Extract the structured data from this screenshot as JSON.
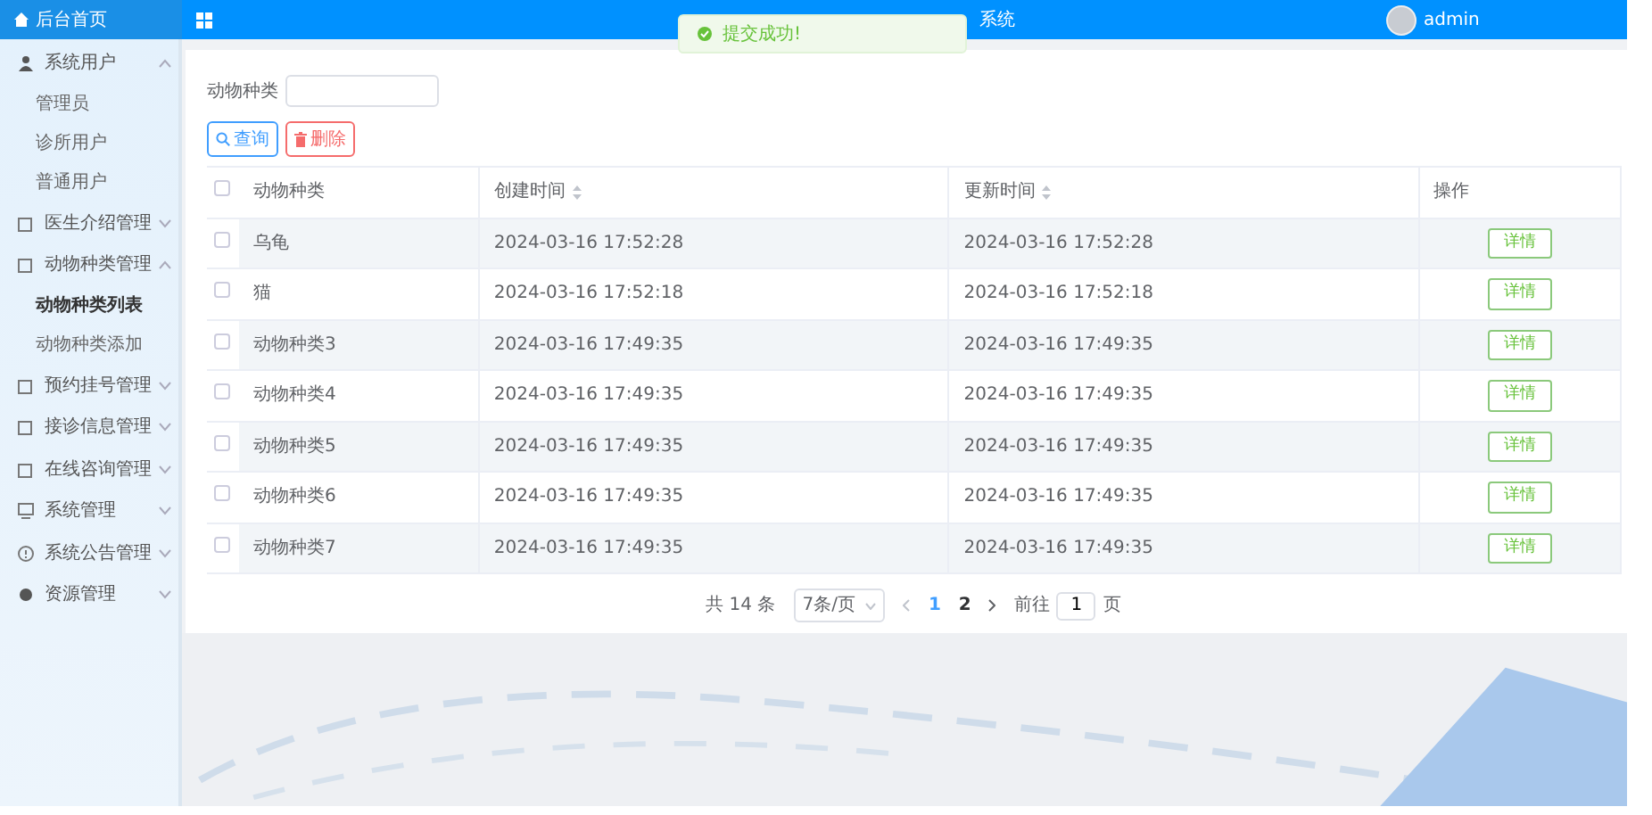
{
  "header": {
    "home_label": "后台首页",
    "title": "系统",
    "user": "admin"
  },
  "toast": {
    "message": "提交成功!"
  },
  "sidebar": {
    "items": [
      {
        "label": "系统用户",
        "expanded": true,
        "children": [
          {
            "label": "管理员",
            "selected": false
          },
          {
            "label": "诊所用户",
            "selected": false
          },
          {
            "label": "普通用户",
            "selected": false
          }
        ]
      },
      {
        "label": "医生介绍管理",
        "expanded": false
      },
      {
        "label": "动物种类管理",
        "expanded": true,
        "children": [
          {
            "label": "动物种类列表",
            "selected": true
          },
          {
            "label": "动物种类添加",
            "selected": false
          }
        ]
      },
      {
        "label": "预约挂号管理",
        "expanded": false
      },
      {
        "label": "接诊信息管理",
        "expanded": false
      },
      {
        "label": "在线咨询管理",
        "expanded": false
      },
      {
        "label": "系统管理",
        "expanded": false
      },
      {
        "label": "系统公告管理",
        "expanded": false
      },
      {
        "label": "资源管理",
        "expanded": false
      }
    ]
  },
  "search": {
    "label": "动物种类"
  },
  "buttons": [
    {
      "kind": "search",
      "label": "查询"
    },
    {
      "kind": "delete",
      "label": "删除"
    }
  ],
  "table": {
    "header_checked": false,
    "columns": [
      {
        "label": "动物种类",
        "sortable": false
      },
      {
        "label": "创建时间",
        "sortable": true
      },
      {
        "label": "更新时间",
        "sortable": true
      },
      {
        "label": "操作",
        "sortable": false
      }
    ],
    "rows": [
      {
        "checked": false,
        "name": "乌龟",
        "created": "2024-03-16 17:52:28",
        "updated": "2024-03-16 17:52:28",
        "action": "详情"
      },
      {
        "checked": false,
        "name": "猫",
        "created": "2024-03-16 17:52:18",
        "updated": "2024-03-16 17:52:18",
        "action": "详情"
      },
      {
        "checked": false,
        "name": "动物种类3",
        "created": "2024-03-16 17:49:35",
        "updated": "2024-03-16 17:49:35",
        "action": "详情"
      },
      {
        "checked": false,
        "name": "动物种类4",
        "created": "2024-03-16 17:49:35",
        "updated": "2024-03-16 17:49:35",
        "action": "详情"
      },
      {
        "checked": false,
        "name": "动物种类5",
        "created": "2024-03-16 17:49:35",
        "updated": "2024-03-16 17:49:35",
        "action": "详情"
      },
      {
        "checked": false,
        "name": "动物种类6",
        "created": "2024-03-16 17:49:35",
        "updated": "2024-03-16 17:49:35",
        "action": "详情"
      },
      {
        "checked": false,
        "name": "动物种类7",
        "created": "2024-03-16 17:49:35",
        "updated": "2024-03-16 17:49:35",
        "action": "详情"
      }
    ]
  },
  "pagination": {
    "total": "共 14 条",
    "page_size": "7条/页",
    "pages": [
      {
        "label": "1",
        "selected": true
      },
      {
        "label": "2",
        "selected": false
      }
    ],
    "goto_label": "前往",
    "goto_value": "1",
    "page_unit": "页"
  }
}
